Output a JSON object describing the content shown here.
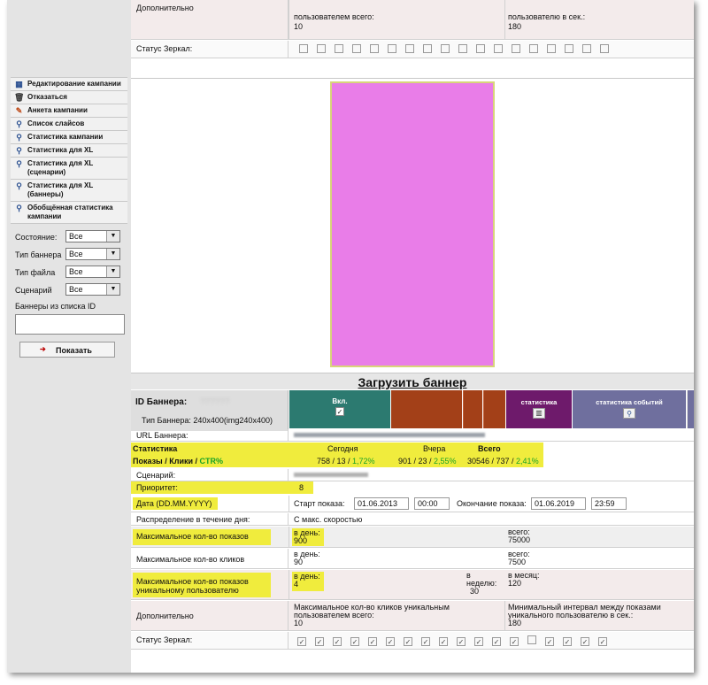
{
  "sidebar": {
    "items": [
      {
        "label": "Редактирование кампании",
        "icon": "grid-icon"
      },
      {
        "label": "Отказаться",
        "icon": "trash-icon"
      },
      {
        "label": "Анкета кампании",
        "icon": "pencil-icon"
      },
      {
        "label": "Список слайсов",
        "icon": "magnifier-icon"
      },
      {
        "label": "Статистика кампании",
        "icon": "magnifier-icon"
      },
      {
        "label": "Статистика для XL",
        "icon": "magnifier-icon"
      },
      {
        "label": "Статистика для XL (сценарии)",
        "icon": "magnifier-icon"
      },
      {
        "label": "Статистика для XL (баннеры)",
        "icon": "magnifier-icon"
      },
      {
        "label": "Обобщённая статистика кампании",
        "icon": "magnifier-icon"
      }
    ],
    "filters": [
      {
        "label": "Состояние:",
        "value": "Все"
      },
      {
        "label": "Тип баннера",
        "value": "Все"
      },
      {
        "label": "Тип файла",
        "value": "Все"
      },
      {
        "label": "Сценарий",
        "value": "Все"
      }
    ],
    "ids_label": "Баннеры из списка ID",
    "show_button": "Показать"
  },
  "top": {
    "additional_label": "Дополнительно",
    "max_clicks_unique_partial": "пользователем всего:",
    "max_clicks_unique_value": "10",
    "min_interval_partial": "пользователю в сек.:",
    "min_interval_value": "180",
    "mirror_status_label": "Статус Зеркал:"
  },
  "upload_label": "Загрузить баннер",
  "banner": {
    "id_label": "ID Баннера:",
    "id_value": "??????",
    "type_label": "Тип Баннера:",
    "type_value": "240x400(img240x400)",
    "toggle_label": "Вкл.",
    "toggle_check": "✓",
    "stats_label": "статистика",
    "events_label": "статистика событий",
    "url_label": "URL Баннера:",
    "scenario_label": "Сценарий:",
    "priority_label": "Приоритет:",
    "priority_value": "8",
    "date_label": "Дата (DD.MM.YYYY)",
    "start_label": "Старт показа:",
    "start_date": "01.06.2013",
    "start_time": "00:00",
    "end_label": "Окончание показа:",
    "end_date": "01.06.2019",
    "end_time": "23:59",
    "distribution_label": "Распределение в течение дня:",
    "distribution_value": "С макс. скоростью"
  },
  "stats": {
    "header": "Статистика",
    "today": "Сегодня",
    "yesterday": "Вчера",
    "total": "Всего",
    "row_label_a": "Показы / Клики / ",
    "row_label_b": "CTR%",
    "today_vals": "758 /  13 / ",
    "today_ctr": "1,72%",
    "yesterday_vals": "901 /  23 / ",
    "yesterday_ctr": "2,55%",
    "total_vals": "30546 / 737 / ",
    "total_ctr": "2,41%"
  },
  "limits": {
    "max_shows_label": "Максимальное кол-во показов",
    "max_clicks_label": "Максимальное кол-во кликов",
    "max_unique_label": "Максимальное кол-во показов уникальному пользователю",
    "per_day": "в день:",
    "total": "всего:",
    "per_week": "в неделю:",
    "per_month": "в месяц:",
    "shows_day": "900",
    "shows_total": "75000",
    "clicks_day": "90",
    "clicks_total": "7500",
    "unique_day": "4",
    "unique_week": "30",
    "unique_month": "120"
  },
  "bottom": {
    "additional_label": "Дополнительно",
    "max_clicks_unique": "Максимальное кол-во кликов уникальным пользователем всего:",
    "max_clicks_unique_value": "10",
    "min_interval": "Минимальный интервал между показами уникального пользователю в сек.:",
    "min_interval_value": "180",
    "mirror_status_label": "Статус Зеркал:",
    "checked": "✓"
  },
  "colors": {
    "teal": "#2c7a70",
    "rust": "#a34018",
    "purple": "#6e1a6b",
    "slate": "#6f6f9e",
    "banner": "#e97de8",
    "highlight": "#f0ec3d"
  }
}
